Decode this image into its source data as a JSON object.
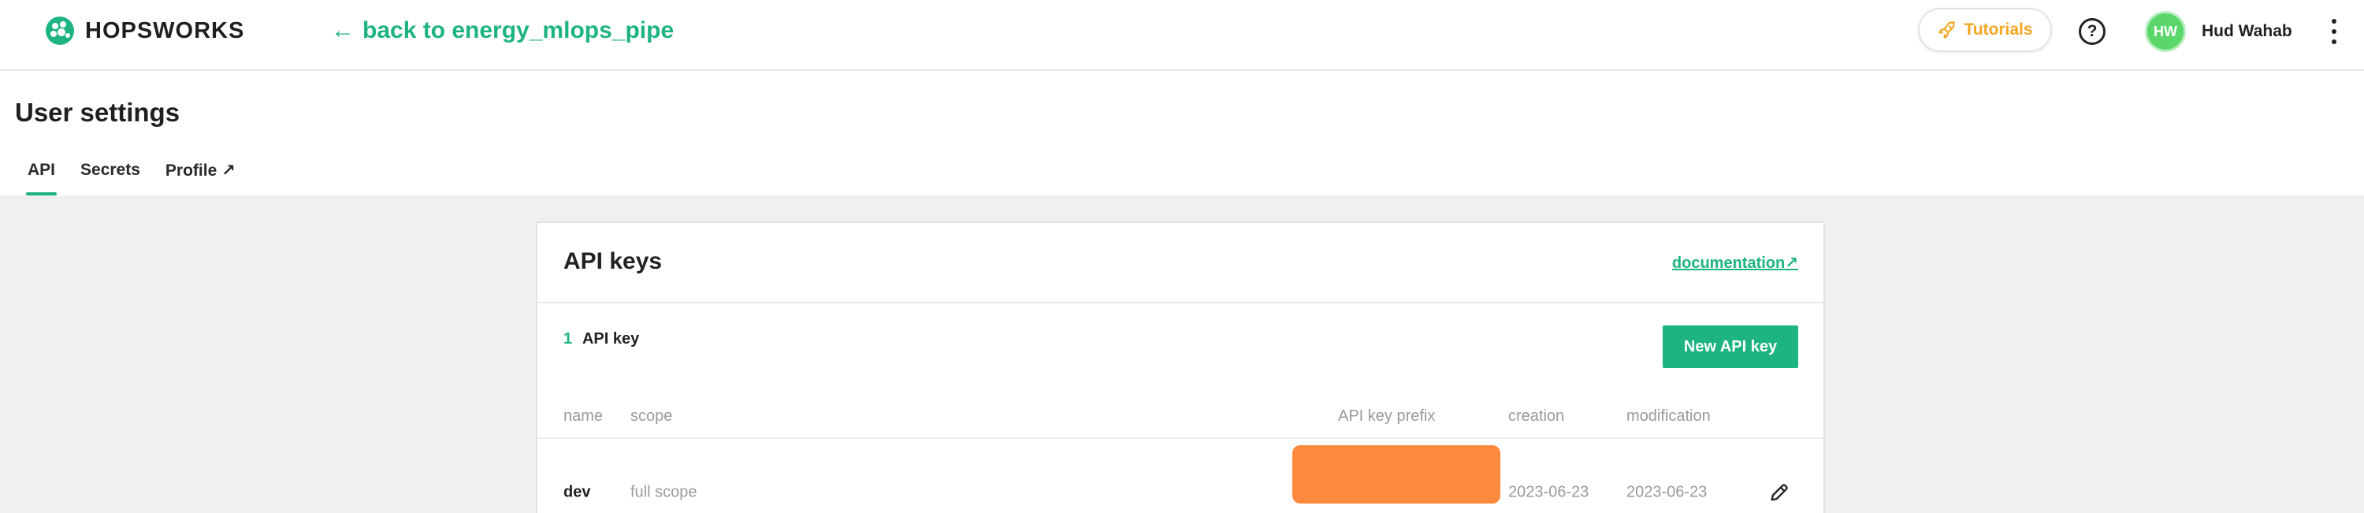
{
  "topbar": {
    "brand": "HOPSWORKS",
    "back_link": "back to energy_mlops_pipe",
    "back_arrow": "←",
    "tutorials_label": "Tutorials",
    "help_glyph": "?",
    "user": {
      "initials": "HW",
      "name": "Hud Wahab"
    }
  },
  "page": {
    "title": "User settings",
    "tabs": [
      {
        "label": "API",
        "active": true
      },
      {
        "label": "Secrets",
        "active": false
      },
      {
        "label": "Profile ↗",
        "active": false
      }
    ]
  },
  "api_keys": {
    "title": "API keys",
    "documentation_link": "documentation↗",
    "count": "1",
    "count_label": "API key",
    "new_button": "New API key",
    "columns": {
      "name": "name",
      "scope": "scope",
      "prefix": "API key prefix",
      "creation": "creation",
      "modification": "modification"
    },
    "rows": [
      {
        "name": "dev",
        "scope": "full scope",
        "prefix": "",
        "creation": "2023-06-23",
        "modification": "2023-06-23"
      }
    ]
  },
  "icons": {
    "logo": "hopsworks-logo-icon",
    "tutorials": "rocket-icon",
    "help": "help-circle-icon",
    "menu": "kebab-menu-icon",
    "edit": "pencil-icon"
  },
  "colors": {
    "accent": "#1eb382",
    "tutorials": "#f5a623",
    "avatar": "#5ad66a",
    "redaction": "#ff8a3d",
    "background": "#f0f0f0"
  }
}
